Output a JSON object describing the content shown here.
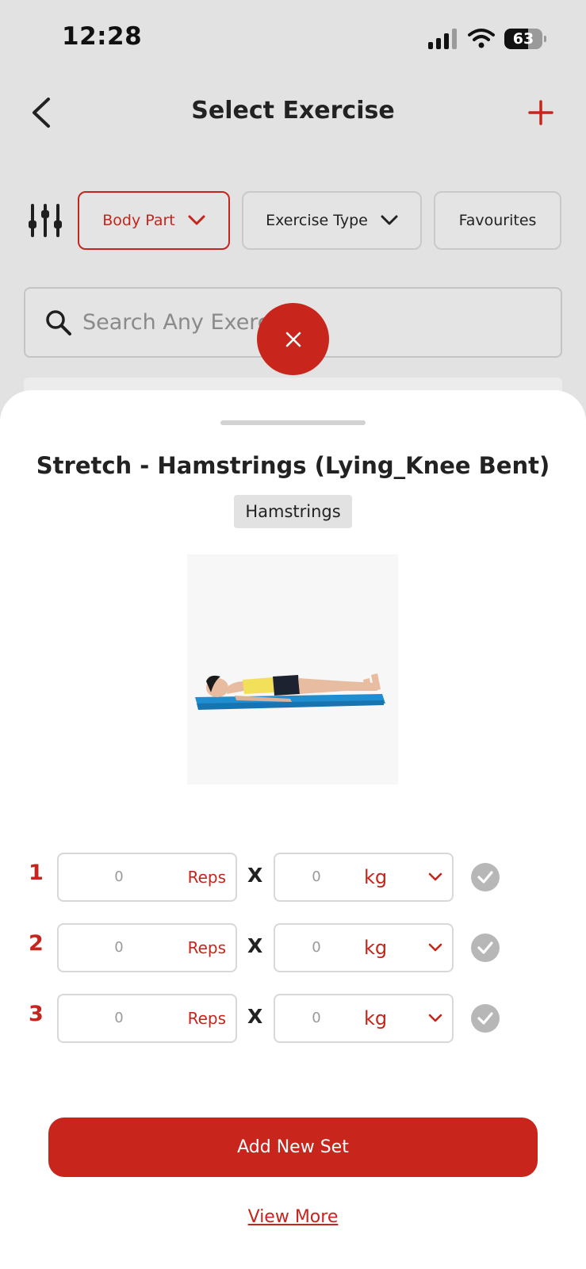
{
  "status_bar": {
    "time": "12:28",
    "battery_level": 63,
    "battery_label": "63"
  },
  "header": {
    "title": "Select Exercise"
  },
  "filters": {
    "body_part": "Body Part",
    "exercise_type": "Exercise Type",
    "favourites": "Favourites"
  },
  "search": {
    "placeholder": "Search Any Exercise",
    "value": ""
  },
  "sheet": {
    "exercise_name": "Stretch - Hamstrings (Lying_Knee Bent)",
    "muscle_tag": "Hamstrings",
    "sets": [
      {
        "number": "1",
        "reps": "0",
        "reps_unit": "Reps",
        "separator": "X",
        "weight": "0",
        "weight_unit": "kg"
      },
      {
        "number": "2",
        "reps": "0",
        "reps_unit": "Reps",
        "separator": "X",
        "weight": "0",
        "weight_unit": "kg"
      },
      {
        "number": "3",
        "reps": "0",
        "reps_unit": "Reps",
        "separator": "X",
        "weight": "0",
        "weight_unit": "kg"
      }
    ],
    "add_set_label": "Add New Set",
    "view_more_label": "View More"
  },
  "colors": {
    "accent": "#c8261d",
    "overlay_background": "#e2e2e2",
    "sheet_background": "#ffffff",
    "check_inactive": "#b7b7b7"
  },
  "icons": {
    "back": "chevron-left-icon",
    "add": "plus-icon",
    "filter": "sliders-icon",
    "dropdown": "chevron-down-icon",
    "search": "search-icon",
    "close": "close-icon",
    "check": "check-icon"
  }
}
